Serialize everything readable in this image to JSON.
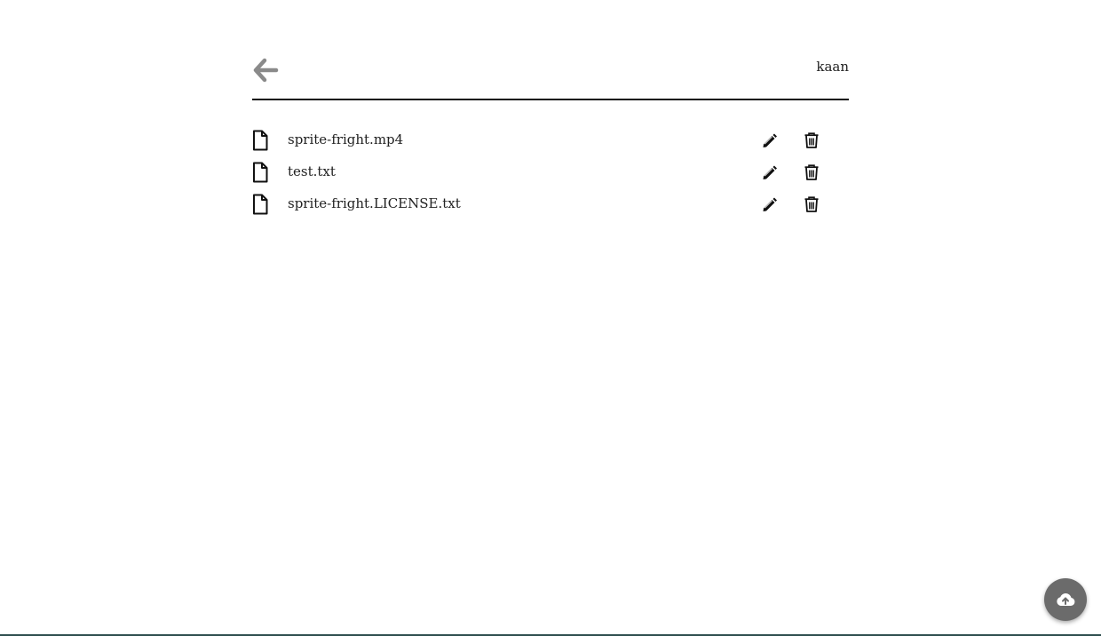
{
  "header": {
    "back_icon": "arrow-left-icon",
    "username": "kaan"
  },
  "files": [
    {
      "name": "sprite-fright.mp4",
      "icon": "file-icon",
      "edit_icon": "pencil-icon",
      "delete_icon": "trash-icon"
    },
    {
      "name": "test.txt",
      "icon": "file-icon",
      "edit_icon": "pencil-icon",
      "delete_icon": "trash-icon"
    },
    {
      "name": "sprite-fright.LICENSE.txt",
      "icon": "file-icon",
      "edit_icon": "pencil-icon",
      "delete_icon": "trash-icon"
    }
  ],
  "upload": {
    "icon": "cloud-upload-icon"
  },
  "colors": {
    "back_arrow": "#8a8a8a",
    "fab_background": "#6b6b6b",
    "header_rule": "#111111"
  }
}
